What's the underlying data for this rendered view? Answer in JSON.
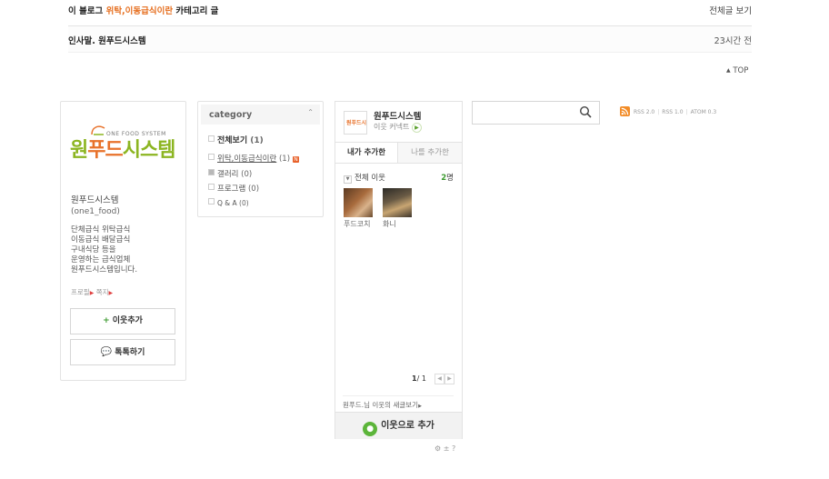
{
  "category_posts": {
    "prefix": "이 블로그 ",
    "category": "위탁,이동급식이란",
    "suffix": " 카테고리 글",
    "view_all": "전체글 보기",
    "posts": [
      {
        "title": "인사말. 원푸드시스템",
        "time": "23시간 전"
      }
    ],
    "top_label": "TOP"
  },
  "profile": {
    "logo_main_green": "원",
    "logo_main_orange": "푸드",
    "logo_main_rest": "시스템",
    "logo_sub": "ONE FOOD SYSTEM",
    "blog_name": "원푸드시스템",
    "blog_id": "(one1_food)",
    "description": [
      "단체급식 위탁급식",
      "이동급식 배달급식",
      "구내식당 등을",
      "운영하는 급식업체",
      "원푸드시스템입니다."
    ],
    "link_profile": "프로필",
    "link_message": "쪽지",
    "add_neighbor": "이웃추가",
    "talk": "톡톡하기"
  },
  "category": {
    "title": "category",
    "items": [
      {
        "name": "전체보기",
        "count": "(1)"
      },
      {
        "name": "위탁,이동급식이란",
        "count": "(1)",
        "new": "N"
      },
      {
        "name": "갤러리",
        "count": "(0)"
      },
      {
        "name": "프로그램",
        "count": "(0)"
      },
      {
        "name": "Q & A",
        "count": "(0)"
      }
    ]
  },
  "neighbor": {
    "thumb_text": "원푸드시스템",
    "title": "원푸드시스템",
    "subtitle": "이웃 커넥트",
    "tab_mine": "내가 추가한",
    "tab_others": "나를 추가한",
    "group": "전체 이웃",
    "count_num": "2",
    "count_unit": "명",
    "friends": [
      {
        "name": "푸드코치"
      },
      {
        "name": "화니"
      }
    ],
    "page_current": "1",
    "page_total": "1",
    "news": "원푸드.님 이웃의 새글보기",
    "add_button": "이웃으로 추가",
    "tools": "⚙ ± ?"
  },
  "search": {
    "value": "",
    "placeholder": ""
  },
  "rss": {
    "rss2": "RSS 2.0",
    "rss1": "RSS 1.0",
    "atom": "ATOM 0.3"
  },
  "colors": {
    "accent_orange": "#e66e1e",
    "accent_green": "#3b9a2e",
    "rss_orange": "#f28c28"
  }
}
